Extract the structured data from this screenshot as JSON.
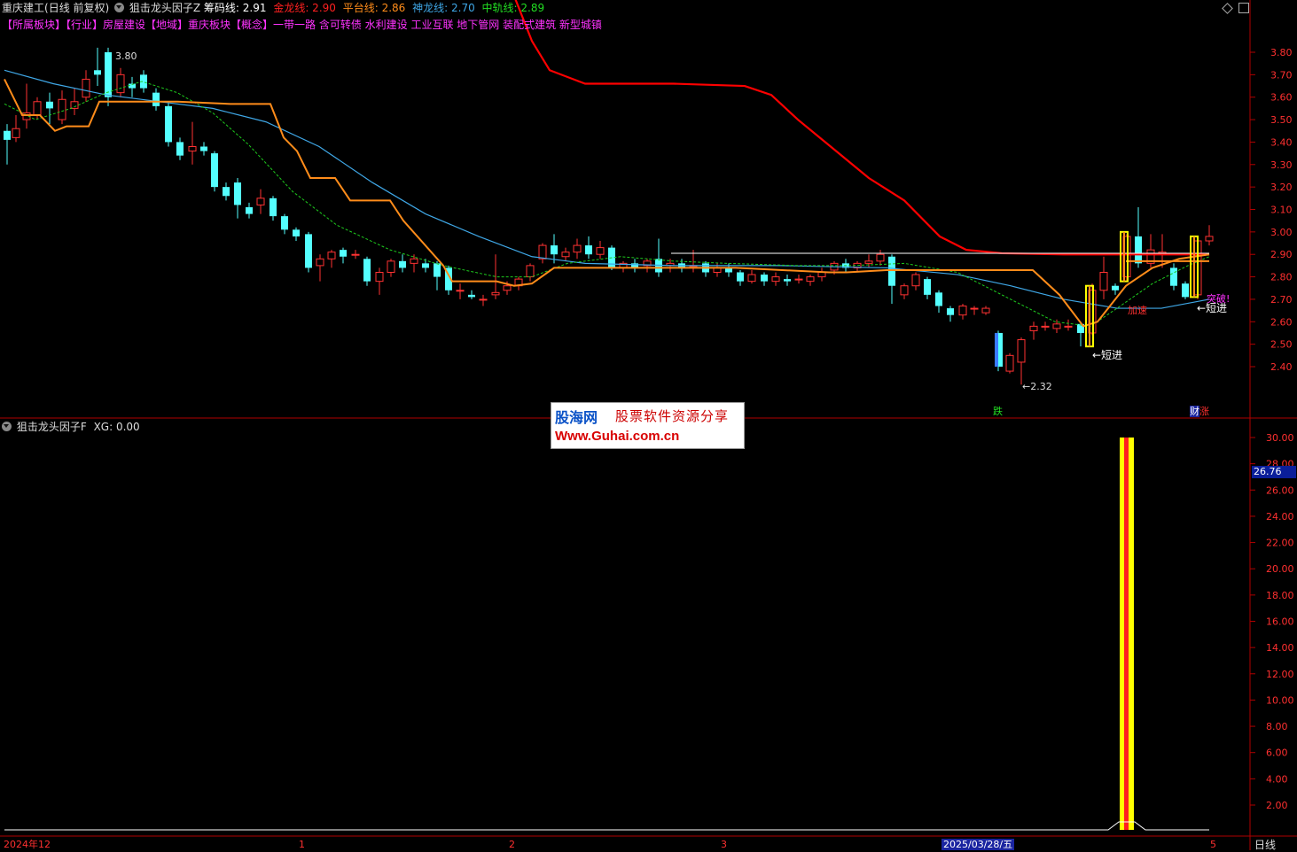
{
  "header": {
    "stock": "重庆建工",
    "mode": "(日线 前复权)",
    "indicator": "狙击龙头因子Z",
    "chip": "筹码线: 2.91",
    "gold": "金龙线: 2.90",
    "platform": "平台线: 2.86",
    "god": "神龙线: 2.70",
    "mid": "中轨线: 2.89",
    "info": "【所属板块】【行业】房屋建设【地域】重庆板块【概念】一带一路 含可转债 水利建设 工业互联 地下管网 装配式建筑 新型城镇"
  },
  "sub": {
    "title": "狙击龙头因子F",
    "xg": "XG: 0.00",
    "current": "26.76"
  },
  "labels": {
    "high": "3.80",
    "low": "←2.32",
    "short1": "←短进",
    "short2": "←短进",
    "accel": "加速",
    "break": "突破!",
    "fall": "跌",
    "cai": "财",
    "zhang": "涨"
  },
  "watermark": {
    "name": "股海网",
    "slogan": "股票软件资源分享",
    "url": "Www.Guhai.com.cn"
  },
  "main_axis": [
    "3.80",
    "3.70",
    "3.60",
    "3.50",
    "3.40",
    "3.30",
    "3.20",
    "3.10",
    "3.00",
    "2.90",
    "2.80",
    "2.70",
    "2.60",
    "2.50",
    "2.40"
  ],
  "sub_axis": [
    "30.00",
    "28.00",
    "26.00",
    "24.00",
    "22.00",
    "20.00",
    "18.00",
    "16.00",
    "14.00",
    "12.00",
    "10.00",
    "8.00",
    "6.00",
    "4.00",
    "2.00"
  ],
  "time_axis": {
    "start": "2024年12",
    "m1": "1",
    "m2": "2",
    "m3": "3",
    "date": "2025/03/28/五",
    "m5": "5",
    "period": "日线"
  },
  "colors": {
    "up": "#ff3232",
    "down": "#54ffff",
    "gold": "#ff0000",
    "platform": "#ff8c1a",
    "god": "#3fa7e6",
    "mid": "#1ecb1e",
    "chip": "#ffffff",
    "bar": "#ffff00"
  },
  "icons": [
    "dropdown-icon",
    "diamond-icon",
    "window-icon"
  ]
}
